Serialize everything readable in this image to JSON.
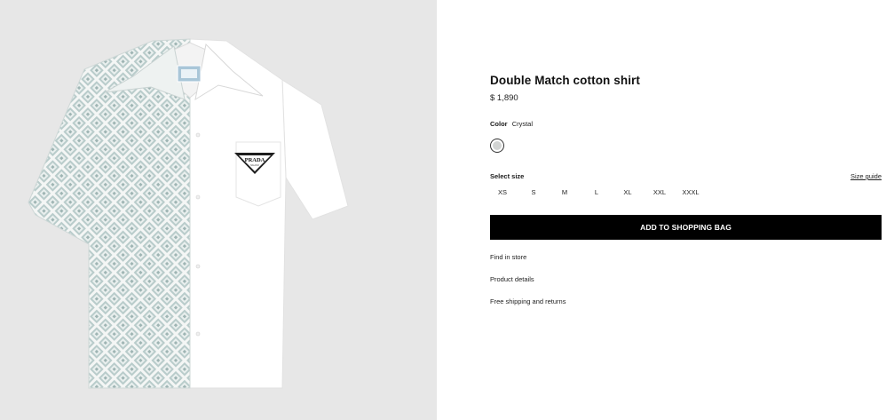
{
  "product": {
    "title": "Double Match cotton shirt",
    "price": "$ 1,890",
    "image_alt": "Double Match cotton shirt product image",
    "logo_text": "PRADA",
    "logo_subtext": "MILANO"
  },
  "color": {
    "label": "Color",
    "value": "Crystal",
    "swatch_hex": "#d2d4d3"
  },
  "size": {
    "label": "Select size",
    "guide_label": "Size guide",
    "options": [
      "XS",
      "S",
      "M",
      "L",
      "XL",
      "XXL",
      "XXXL"
    ]
  },
  "cta": {
    "add_to_bag": "ADD TO SHOPPING BAG"
  },
  "links": {
    "find_in_store": "Find in store",
    "product_details": "Product details",
    "shipping": "Free shipping and returns"
  },
  "colors": {
    "image_bg": "#e7e7e7",
    "button_bg": "#000000",
    "pattern_tile": "#c9d6d5",
    "shirt_white": "#ffffff"
  }
}
